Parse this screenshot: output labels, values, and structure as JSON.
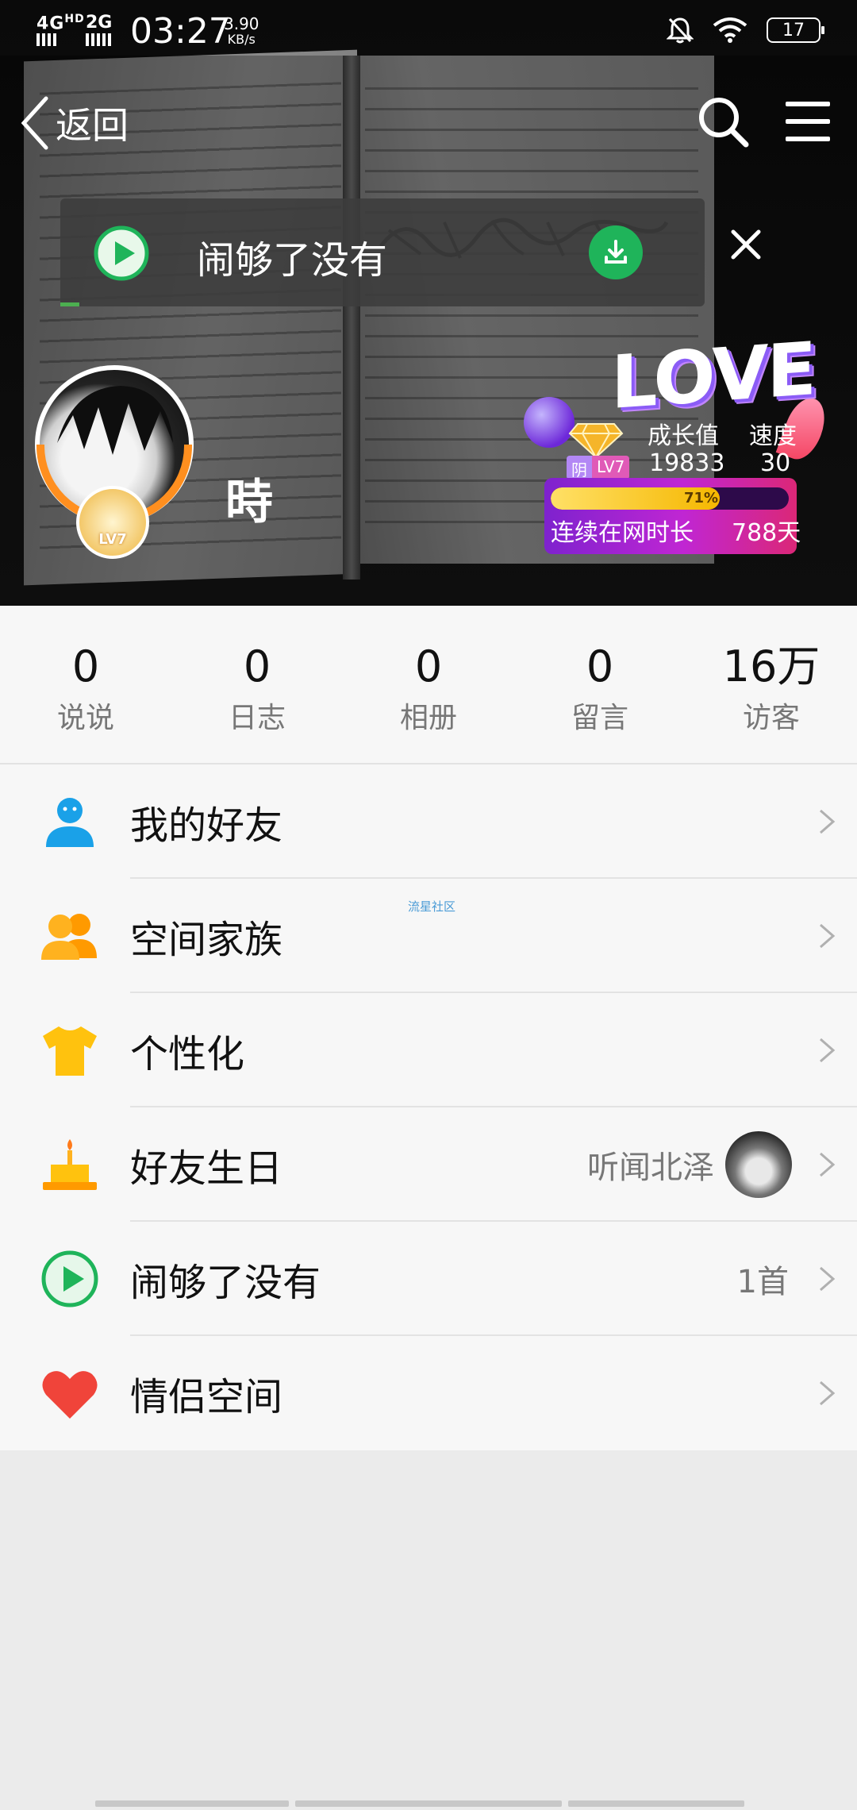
{
  "status_bar": {
    "network1": "4G",
    "network1_sup": "HD",
    "network2": "2G",
    "time": "03:27",
    "speed_value": "3.90",
    "speed_unit": "KB/s",
    "battery": "17"
  },
  "nav": {
    "back_label": "返回"
  },
  "music_bar": {
    "title": "闹够了没有",
    "progress_fraction": 0.03
  },
  "profile": {
    "username": "時",
    "level": "LV7"
  },
  "growth": {
    "love_text": "LOVE",
    "tag_a": "阴",
    "tag_b": "LV7",
    "growth_label": "成长值",
    "growth_value": "19833",
    "speed_label": "速度",
    "speed_value": "30",
    "progress_percent": 71,
    "progress_text": "71%",
    "online_label": "连续在网时长",
    "online_value": "788天"
  },
  "stats": [
    {
      "num": "0",
      "label": "说说"
    },
    {
      "num": "0",
      "label": "日志"
    },
    {
      "num": "0",
      "label": "相册"
    },
    {
      "num": "0",
      "label": "留言"
    },
    {
      "num": "16万",
      "label": "访客"
    }
  ],
  "menu": [
    {
      "label": "我的好友",
      "icon": "friends-icon"
    },
    {
      "label": "空间家族",
      "icon": "family-icon"
    },
    {
      "label": "个性化",
      "icon": "tshirt-icon"
    },
    {
      "label": "好友生日",
      "icon": "cake-icon",
      "trail": "听闻北泽"
    },
    {
      "label": "闹够了没有",
      "icon": "music-play-icon",
      "trail": "1首"
    },
    {
      "label": "情侣空间",
      "icon": "heart-icon"
    }
  ],
  "watermark": "流星社区",
  "colors": {
    "accent_green": "#1fb45a",
    "avatar_ring": "#ff8f1f",
    "friends_blue": "#1aa1e8",
    "family_orange": "#ffaa1a",
    "heart_red": "#f0443a"
  }
}
